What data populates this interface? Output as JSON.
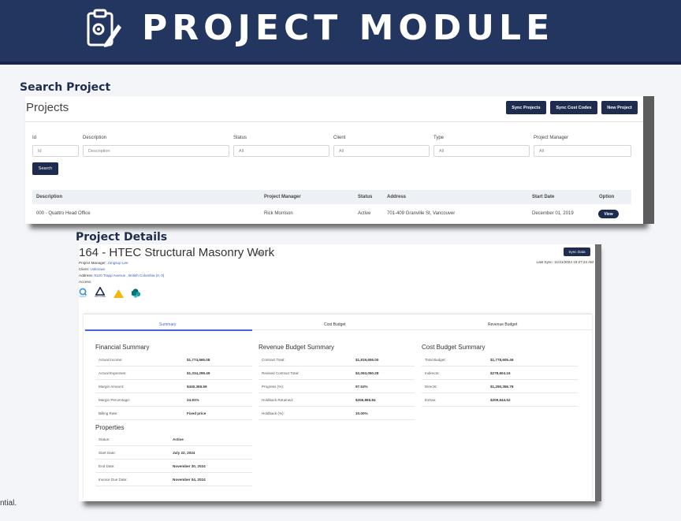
{
  "banner": {
    "title": "PROJECT MODULE",
    "icon": "clipboard-gear-pencil-icon"
  },
  "search_section": {
    "heading": "Search Project",
    "page_title": "Projects",
    "buttons": {
      "sync_projects": "Sync Projects",
      "sync_cost_codes": "Sync Cost Codes",
      "new_project": "New Project"
    },
    "filters": {
      "id": {
        "label": "Id",
        "placeholder": "Id"
      },
      "description": {
        "label": "Description",
        "placeholder": "Description"
      },
      "status": {
        "label": "Status",
        "value": "All"
      },
      "client": {
        "label": "Client",
        "value": "All"
      },
      "type": {
        "label": "Type",
        "value": "All"
      },
      "project_manager": {
        "label": "Project Manager",
        "value": "All"
      }
    },
    "search_button": "Search",
    "table": {
      "headers": {
        "description": "Description",
        "project_manager": "Project Manager",
        "status": "Status",
        "address": "Address",
        "start_date": "Start Date",
        "option": "Option"
      },
      "rows": [
        {
          "description": "000 - Quattro Head Office",
          "project_manager": "Rick Morrison",
          "status": "Active",
          "address": "701-409 Granville St, Vancouver",
          "start_date": "December 01, 2019",
          "option": "View"
        }
      ]
    }
  },
  "details_section": {
    "heading": "Project Details",
    "title": "164 - HTEC Structural Masonry Work",
    "edit_label": "Edit",
    "project_manager_label": "Project Manager:",
    "project_manager": "Jongsup Lee",
    "client_label": "Client:",
    "client": "Unknown",
    "address_label": "Address:",
    "address": "8120 Trapp Avenue , British Columbia (0, 0)",
    "access_label": "Access:",
    "sync_button": "Sync Data",
    "last_sync": "Last Sync: 11/21/2024 10:27:24 AM",
    "access_icons": [
      "quattro-icon",
      "procore-icon",
      "warning-triangle-icon",
      "sharepoint-icon"
    ],
    "access_icon_captions": {
      "quattro": "Quattro",
      "procore": "PRO.CORE"
    },
    "tabs": [
      "Summary",
      "Cost Budget",
      "Revenue Budget"
    ],
    "financial_summary": {
      "title": "Financial Summary",
      "rows": [
        {
          "k": "Actual Income:",
          "v": "$1,774,665.08"
        },
        {
          "k": "Actual Expenses:",
          "v": "$1,334,299.49"
        },
        {
          "k": "Margin Amount:",
          "v": "$440,365.59"
        },
        {
          "k": "Margin Percentage:",
          "v": "24.81%"
        },
        {
          "k": "Billing Rate:",
          "v": "Fixed price"
        }
      ]
    },
    "revenue_budget_summary": {
      "title": "Revenue Budget Summary",
      "rows": [
        {
          "k": "Contract Total:",
          "v": "$1,819,655.00"
        },
        {
          "k": "Revised Contract Total:",
          "v": "$2,063,050.28"
        },
        {
          "k": "Progress (%):",
          "v": "97.53%"
        },
        {
          "k": "Holdback Retained:",
          "v": "$256,865.84"
        },
        {
          "k": "Holdback (%):",
          "v": "10.00%"
        }
      ]
    },
    "cost_budget_summary": {
      "title": "Cost Budget Summary",
      "rows": [
        {
          "k": "Total Budget:",
          "v": "$1,778,605.46"
        },
        {
          "k": "Indirects:",
          "v": "$278,604.16"
        },
        {
          "k": "Directs:",
          "v": "$1,290,356.78"
        },
        {
          "k": "Extras:",
          "v": "$209,644.52"
        }
      ]
    },
    "properties": {
      "title": "Properties",
      "rows": [
        {
          "k": "Status:",
          "v": "Active"
        },
        {
          "k": "Start Date:",
          "v": "July 22, 2024"
        },
        {
          "k": "End Date:",
          "v": "November 30, 2024"
        },
        {
          "k": "Invoice Due Date:",
          "v": "November 04, 2024"
        }
      ]
    }
  },
  "footer_fragment": "ntial.",
  "colors": {
    "navy": "#233660",
    "button": "#1d2c4f",
    "accent": "#4b63d8"
  }
}
